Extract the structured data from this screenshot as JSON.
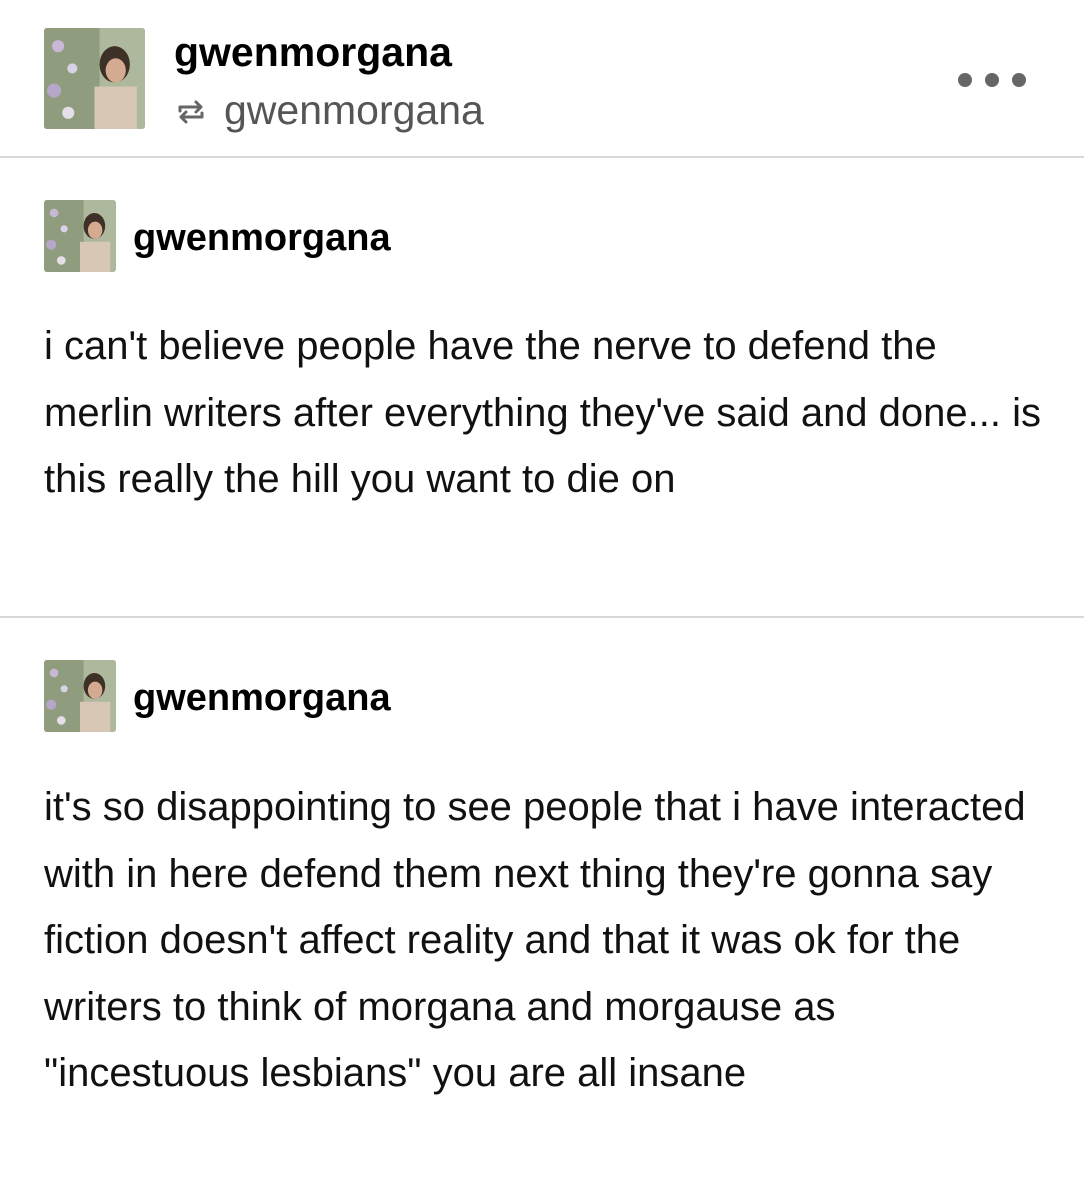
{
  "header": {
    "blog_name": "gwenmorgana",
    "reblogged_from": "gwenmorgana",
    "reblog_icon": "reblog-icon",
    "more_icon": "more-options-icon"
  },
  "posts": [
    {
      "author": "gwenmorgana",
      "text": "i can't believe people have the nerve to defend the merlin writers after everything they've said and done... is this really the hill you want to die on"
    },
    {
      "author": "gwenmorgana",
      "text": "it's so disappointing to see people that i have interacted with in here defend them next thing they're gonna say fiction doesn't affect reality and that it was ok for the writers to think of morgana and morgause as \"incestuous lesbians\" you are all insane"
    }
  ],
  "colors": {
    "text": "#000000",
    "secondary_text": "#555555",
    "divider": "#d8d8d8",
    "background": "#ffffff"
  }
}
